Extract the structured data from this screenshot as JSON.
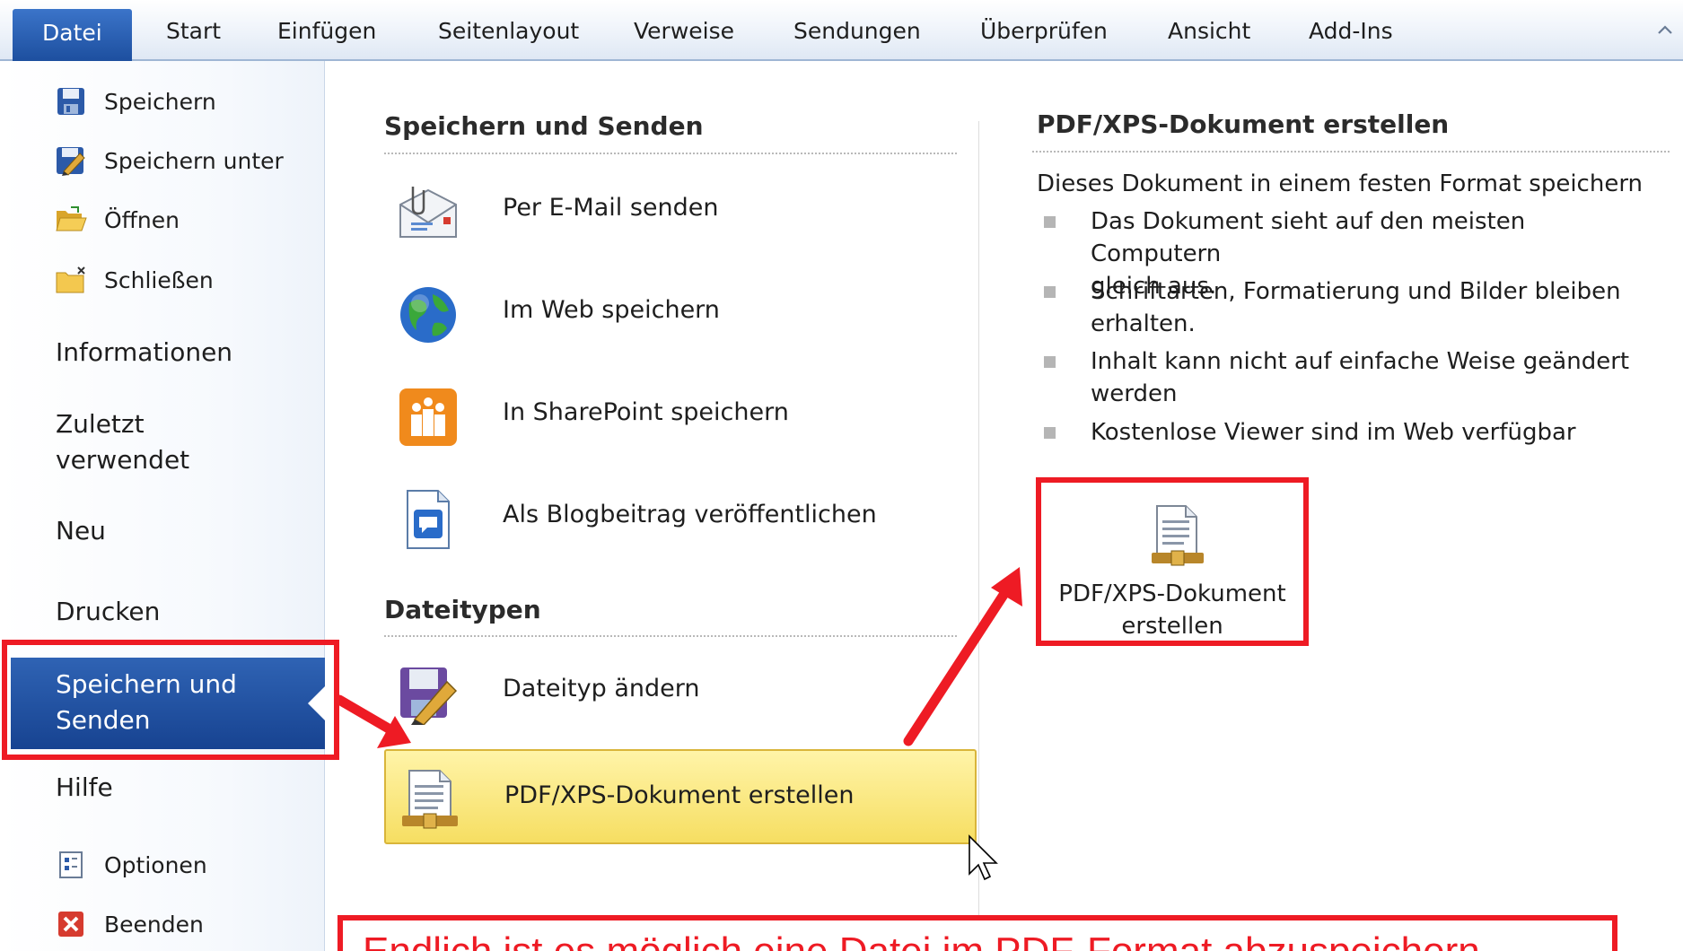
{
  "ribbon": {
    "tabs": [
      {
        "label": "Datei",
        "active": true
      },
      {
        "label": "Start"
      },
      {
        "label": "Einfügen"
      },
      {
        "label": "Seitenlayout"
      },
      {
        "label": "Verweise"
      },
      {
        "label": "Sendungen"
      },
      {
        "label": "Überprüfen"
      },
      {
        "label": "Ansicht"
      },
      {
        "label": "Add-Ins"
      }
    ]
  },
  "nav": {
    "commands_top": [
      {
        "label": "Speichern",
        "icon": "save-icon"
      },
      {
        "label": "Speichern unter",
        "icon": "save-as-icon"
      },
      {
        "label": "Öffnen",
        "icon": "open-folder-icon"
      },
      {
        "label": "Schließen",
        "icon": "close-folder-icon"
      }
    ],
    "pages": {
      "informationen": "Informationen",
      "zuletzt_1": "Zuletzt",
      "zuletzt_2": "verwendet",
      "neu": "Neu",
      "drucken": "Drucken",
      "speichern_senden_1": "Speichern und",
      "speichern_senden_2": "Senden",
      "hilfe": "Hilfe"
    },
    "commands_bottom": [
      {
        "label": "Optionen",
        "icon": "options-icon"
      },
      {
        "label": "Beenden",
        "icon": "exit-icon"
      }
    ]
  },
  "middle": {
    "section1_title": "Speichern und Senden",
    "items": [
      {
        "label": "Per E-Mail senden",
        "icon": "email-attachment-icon"
      },
      {
        "label": "Im Web speichern",
        "icon": "globe-icon"
      },
      {
        "label": "In SharePoint speichern",
        "icon": "sharepoint-icon"
      },
      {
        "label": "Als Blogbeitrag veröffentlichen",
        "icon": "blog-post-icon"
      }
    ],
    "section2_title": "Dateitypen",
    "filetype_items": [
      {
        "label": "Dateityp ändern",
        "icon": "change-filetype-icon"
      },
      {
        "label": "PDF/XPS-Dokument erstellen",
        "icon": "pdf-xps-icon",
        "selected": true
      }
    ]
  },
  "right": {
    "title": "PDF/XPS-Dokument erstellen",
    "intro": "Dieses Dokument in einem festen Format speichern",
    "bullets": [
      {
        "line1": "Das Dokument sieht auf den meisten Computern",
        "line2": "gleich aus."
      },
      {
        "line1": "Schriftarten, Formatierung und Bilder bleiben",
        "line2": "erhalten."
      },
      {
        "line1": "Inhalt kann nicht auf einfache Weise geändert",
        "line2": "werden"
      },
      {
        "line1": "Kostenlose Viewer sind im Web verfügbar",
        "line2": ""
      }
    ],
    "button_line1": "PDF/XPS-Dokument",
    "button_line2": "erstellen"
  },
  "annotation": {
    "caption": "Endlich ist es möglich eine Datei im PDF-Format abzuspeichern",
    "color": "#ee1b24"
  },
  "colors": {
    "accent_blue": "#2f63b4",
    "selected_yellow": "#f6de62",
    "annotation_red": "#ee1b24"
  }
}
